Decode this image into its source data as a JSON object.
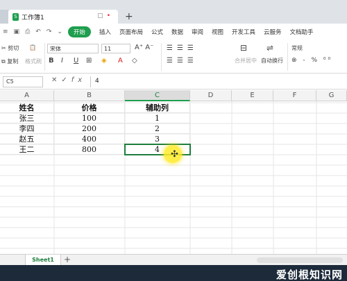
{
  "window": {
    "doc_tab_title": "工作簿1",
    "new_tab_symbol": "+"
  },
  "menu": {
    "items": [
      "开始",
      "插入",
      "页面布局",
      "公式",
      "数据",
      "审阅",
      "视图",
      "开发工具",
      "云服务",
      "文档助手"
    ]
  },
  "ribbon": {
    "cut": "剪切",
    "copy": "复制",
    "format_painter": "格式刷",
    "font_name": "宋体",
    "font_size": "11",
    "bold": "B",
    "italic": "I",
    "underline": "U",
    "merge_center": "合并居中",
    "wrap_text": "自动换行",
    "number_format": "常规"
  },
  "formula_bar": {
    "name_box": "C5",
    "fx_label": "fx",
    "value": "4"
  },
  "columns": [
    "A",
    "B",
    "C",
    "D",
    "E",
    "F",
    "G"
  ],
  "active_column": "C",
  "table": {
    "headers": [
      "姓名",
      "价格",
      "辅助列"
    ],
    "rows": [
      [
        "张三",
        "100",
        "1"
      ],
      [
        "李四",
        "200",
        "2"
      ],
      [
        "赵五",
        "400",
        "3"
      ],
      [
        "王二",
        "800",
        "4"
      ]
    ]
  },
  "selected_cell": "C5",
  "sheets": {
    "tabs": [
      "Sheet1"
    ],
    "add_symbol": "+"
  },
  "watermark": "爱创根知识网",
  "colors": {
    "accent": "#1e9e4e",
    "selection_border": "#1e7e3e",
    "taskbar": "#1c2a3a",
    "cursor_highlight": "#ffeb28"
  }
}
